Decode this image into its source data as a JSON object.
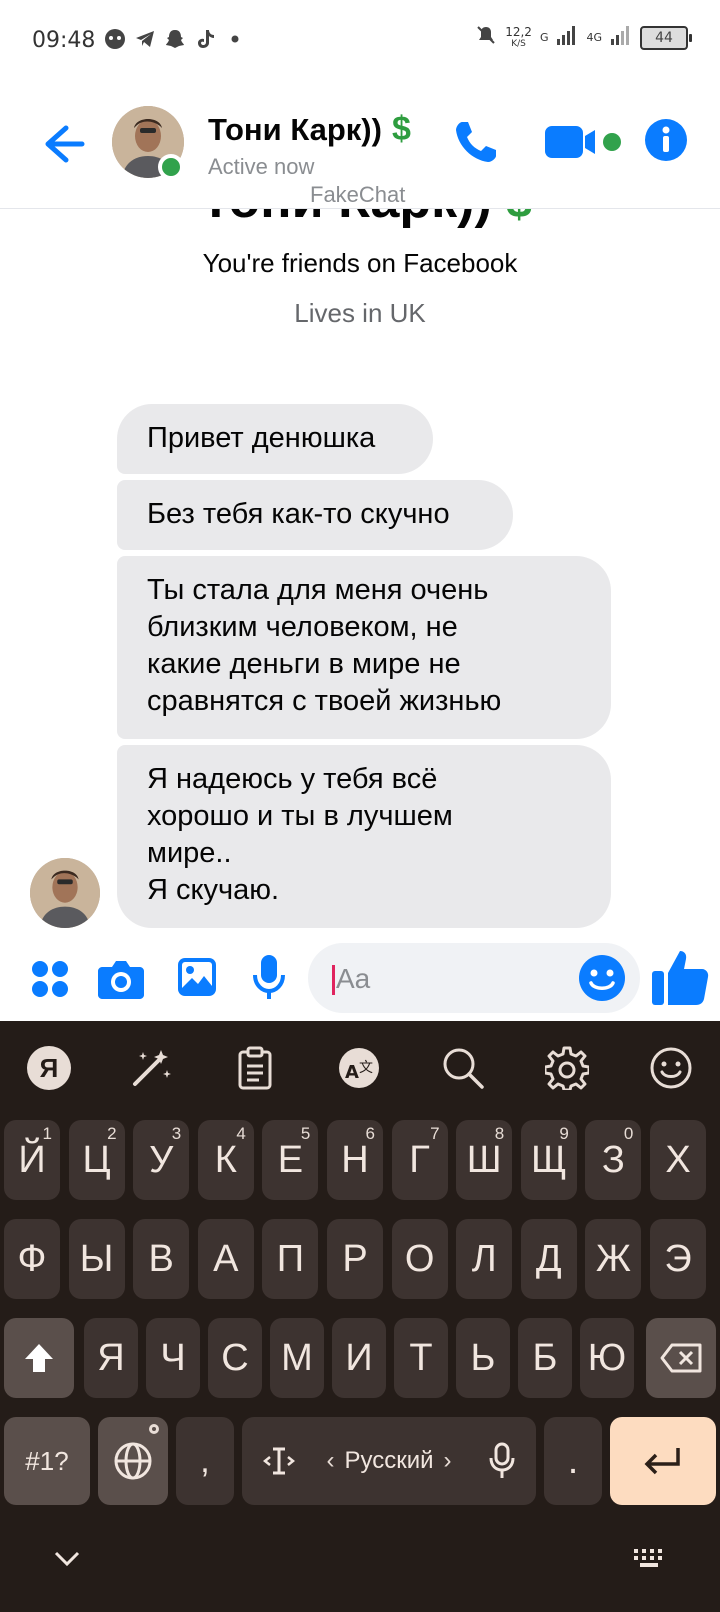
{
  "status_bar": {
    "time": "09:48",
    "speed_value": "12,2",
    "speed_unit": "K/S",
    "network_1": "G",
    "network_2": "4G",
    "battery": "44"
  },
  "header": {
    "name": "Тони Карк))",
    "money_emoji": "$",
    "status": "Active now",
    "watermark": "FakeChat"
  },
  "profile": {
    "name": "Тони Карк))",
    "friends_text": "You're friends on Facebook",
    "lives_text": "Lives in UK"
  },
  "messages": [
    {
      "text": "Привет денюшка"
    },
    {
      "text": "Без тебя как-то скучно"
    },
    {
      "text": "Ты стала для меня очень\nблизким человеком, не\nкакие деньги в мире не\nсравнятся с твоей жизнью"
    },
    {
      "text": "Я надеюсь у тебя всё\nхорошо и ты в лучшем\nмире..\nЯ скучаю."
    }
  ],
  "composer": {
    "placeholder": "Aa"
  },
  "keyboard": {
    "toolbar": {
      "yandex_label": "Я"
    },
    "row1": [
      {
        "char": "Й",
        "sup": "1"
      },
      {
        "char": "Ц",
        "sup": "2"
      },
      {
        "char": "У",
        "sup": "3"
      },
      {
        "char": "К",
        "sup": "4"
      },
      {
        "char": "Е",
        "sup": "5"
      },
      {
        "char": "Н",
        "sup": "6"
      },
      {
        "char": "Г",
        "sup": "7"
      },
      {
        "char": "Ш",
        "sup": "8"
      },
      {
        "char": "Щ",
        "sup": "9"
      },
      {
        "char": "З",
        "sup": "0"
      },
      {
        "char": "Х",
        "sup": ""
      }
    ],
    "row2": [
      "Ф",
      "Ы",
      "В",
      "А",
      "П",
      "Р",
      "О",
      "Л",
      "Д",
      "Ж",
      "Э"
    ],
    "row3": [
      "Я",
      "Ч",
      "С",
      "М",
      "И",
      "Т",
      "Ь",
      "Б",
      "Ю"
    ],
    "symbols_label": "#1?",
    "comma": ",",
    "space_label": "Русский",
    "space_left_arrow": "‹",
    "space_right_arrow": "›",
    "period": "."
  },
  "colors": {
    "accent": "#0a7cff",
    "online": "#31a24c",
    "money": "#2e9d3f",
    "bubble": "#e9e9eb",
    "keyboard_bg": "#241c18",
    "key_bg": "#3d3330",
    "enter_bg": "#fddcc0"
  }
}
